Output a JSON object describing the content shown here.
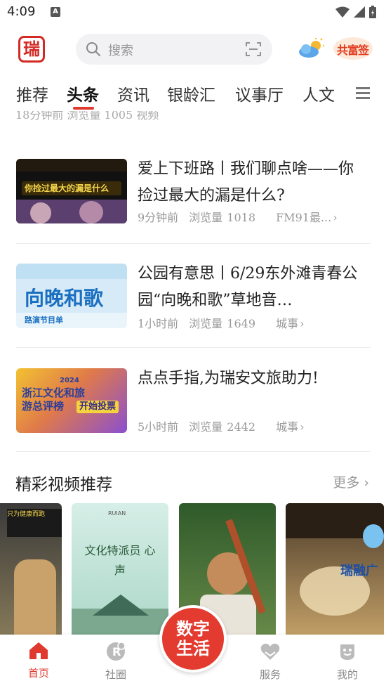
{
  "status": {
    "time": "4:09"
  },
  "header": {
    "logo_text": "瑞",
    "search_placeholder": "搜索",
    "brand_badge": "共富签"
  },
  "tabs": [
    {
      "label": "推荐"
    },
    {
      "label": "头条"
    },
    {
      "label": "资讯"
    },
    {
      "label": "银龄汇"
    },
    {
      "label": "议事厅"
    },
    {
      "label": "人文"
    }
  ],
  "feed": {
    "prev_meta": "18分钟前    浏览量  1005        视频",
    "articles": [
      {
        "title": "爱上下班路丨我们聊点啥——你捡过最大的漏是什么?",
        "time": "9分钟前",
        "views_label": "浏览量",
        "views": "1018",
        "source": "FM91最...",
        "thumb_text": "你捡过最大的漏是什么"
      },
      {
        "title": "公园有意思丨6/29东外滩青春公园“向晚和歌”草地音…",
        "time": "1小时前",
        "views_label": "浏览量",
        "views": "1649",
        "source": "城事",
        "thumb_text": "向晚和歌",
        "thumb_sub": "路演节目单"
      },
      {
        "title": "点点手指,为瑞安文旅助力!",
        "time": "5小时前",
        "views_label": "浏览量",
        "views": "2442",
        "source": "城事",
        "thumb_text": "浙江文化和旅游总评榜",
        "thumb_badge": "开始投票",
        "thumb_year": "2024"
      }
    ],
    "video_section": {
      "title": "精彩视频推荐",
      "more": "更多",
      "cards": [
        {
          "caption": "只为健康而跑"
        },
        {
          "caption": "文化特派员 心声",
          "sub": "RUIAN"
        },
        {
          "caption": ""
        },
        {
          "caption": "瑞融广"
        }
      ]
    }
  },
  "bottom_nav": {
    "items": [
      {
        "label": "首页"
      },
      {
        "label": "社圈"
      },
      {
        "label": "服务"
      },
      {
        "label": "我的"
      }
    ],
    "center_label": "数字生活"
  },
  "colors": {
    "accent": "#e03a2e"
  }
}
